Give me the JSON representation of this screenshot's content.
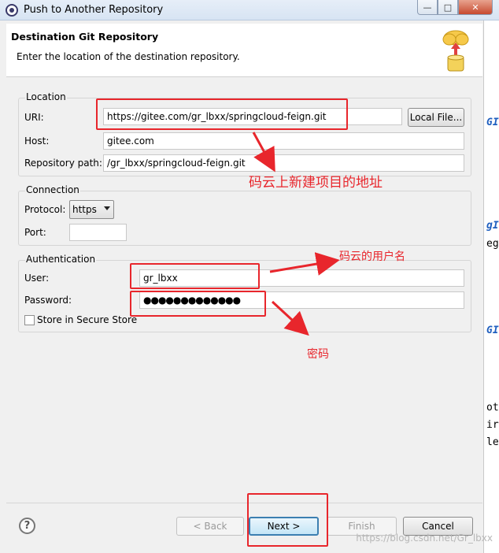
{
  "window": {
    "title": "Push to Another Repository"
  },
  "banner": {
    "title": "Destination Git Repository",
    "description": "Enter the location of the destination repository."
  },
  "location": {
    "group_label": "Location",
    "uri_label": "URI:",
    "uri_value": "https://gitee.com/gr_lbxx/springcloud-feign.git",
    "local_file_button": "Local File...",
    "host_label": "Host:",
    "host_value": "gitee.com",
    "repo_path_label": "Repository path:",
    "repo_path_value": "/gr_lbxx/springcloud-feign.git"
  },
  "connection": {
    "group_label": "Connection",
    "protocol_label": "Protocol:",
    "protocol_value": "https",
    "port_label": "Port:",
    "port_value": ""
  },
  "authentication": {
    "group_label": "Authentication",
    "user_label": "User:",
    "user_value": "gr_lbxx",
    "password_label": "Password:",
    "password_value": "●●●●●●●●●●●●●",
    "store_label": "Store in Secure Store",
    "store_checked": false
  },
  "buttons": {
    "help": "?",
    "back": "< Back",
    "next": "Next >",
    "finish": "Finish",
    "cancel": "Cancel"
  },
  "annotations": {
    "uri_note": "码云上新建项目的地址",
    "user_note": "码云的用户名",
    "password_note": "密码",
    "color": "#e8262c"
  },
  "background": {
    "watermark": "https://blog.csdn.net/Gr_lbxx",
    "sliver_texts": [
      "GI",
      "gI",
      "eg",
      "GI",
      "ot",
      "ir",
      "le"
    ]
  },
  "colors": {
    "accent": "#3c7fb1",
    "annotation": "#e8262c"
  }
}
